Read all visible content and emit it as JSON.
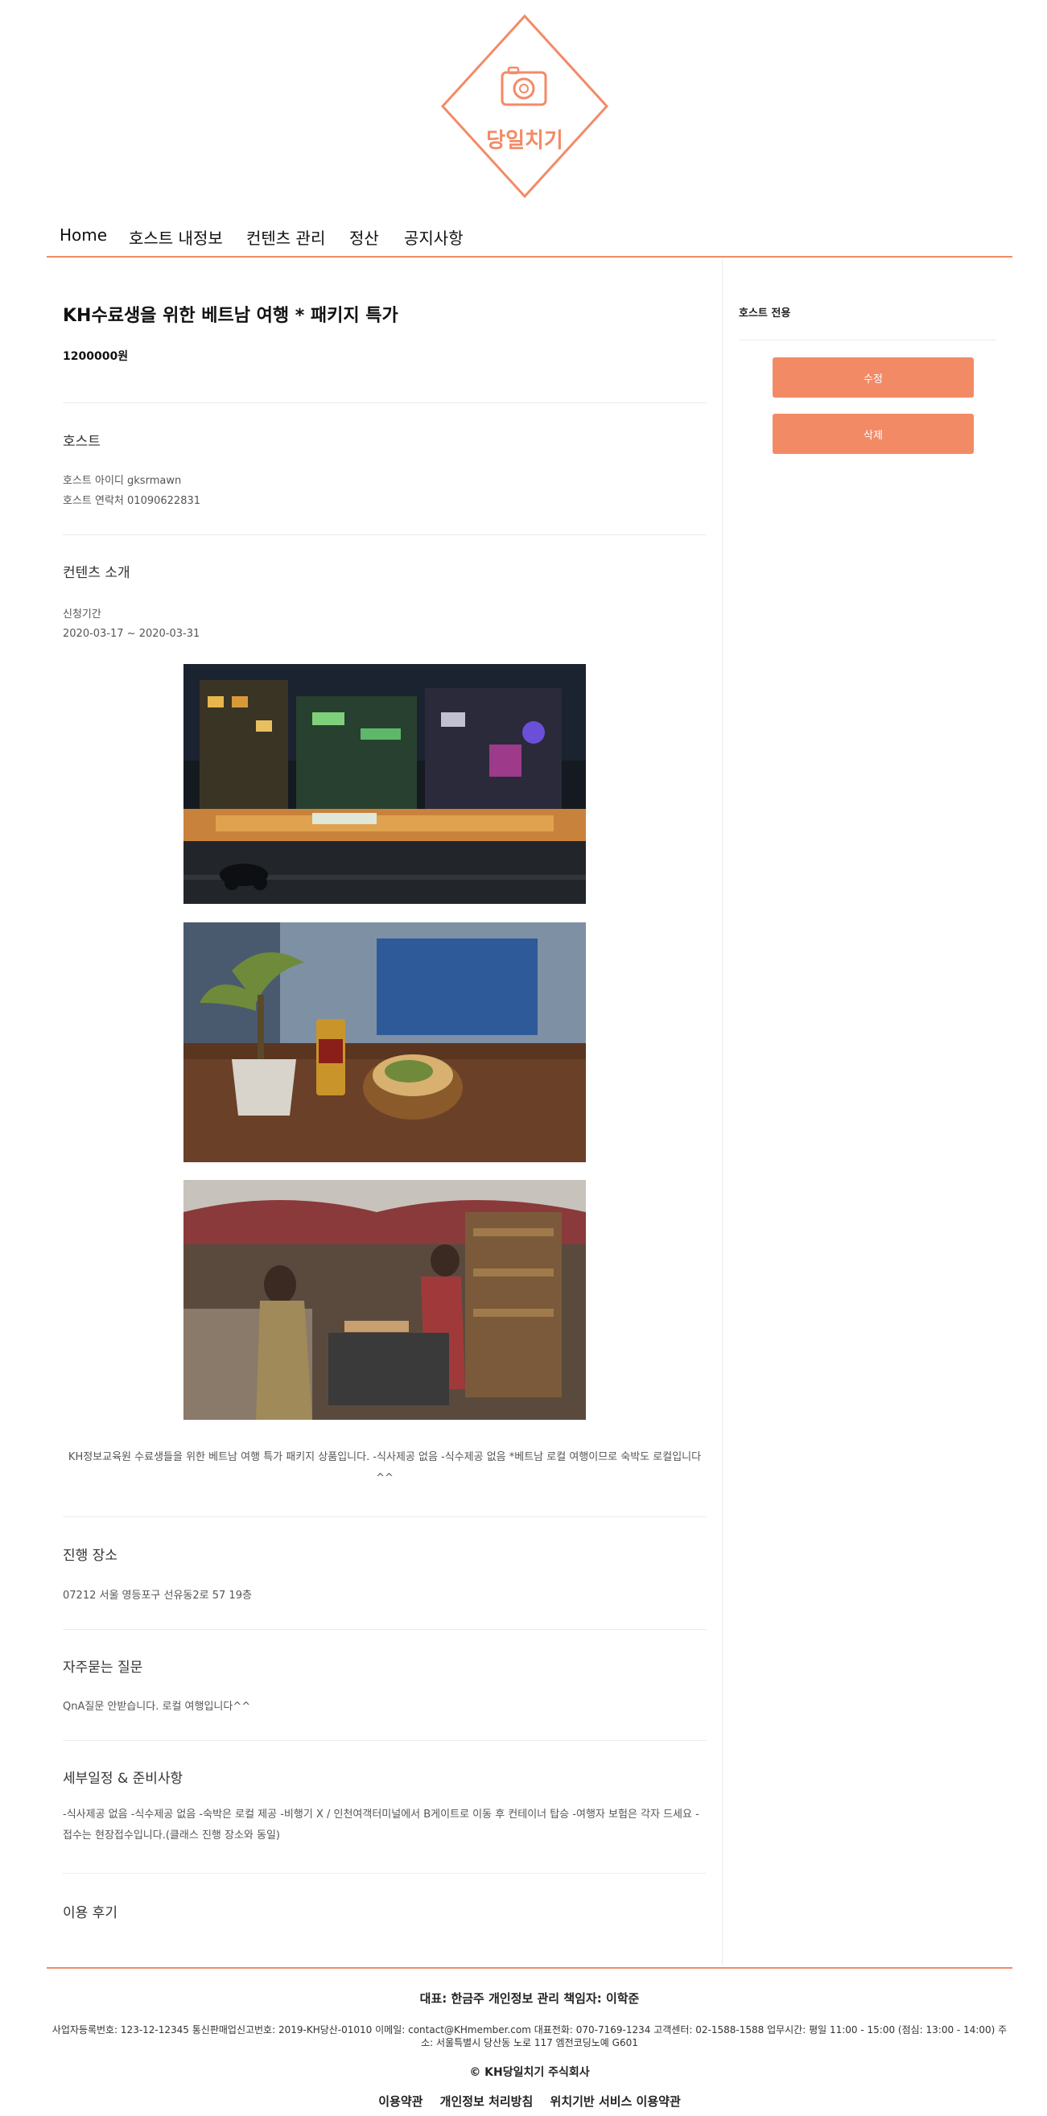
{
  "brand": {
    "name": "당일치기",
    "accent": "#f38a66"
  },
  "nav": {
    "items": [
      "Home",
      "호스트 내정보",
      "컨텐츠 관리",
      "정산",
      "공지사항"
    ]
  },
  "content": {
    "title": "KH수료생을 위한 베트남 여행 * 패키지 특가",
    "price": "1200000원",
    "host": {
      "heading": "호스트",
      "id_line": "호스트 아이디 gksrmawn",
      "contact_line": "호스트 연락처 01090622831"
    },
    "intro": {
      "heading": "컨텐츠 소개",
      "period_label": "신청기간",
      "period": "2020-03-17 ~ 2020-03-31",
      "photos": [
        "night-street-photo",
        "sandwich-beer-photo",
        "market-vendor-photo"
      ],
      "description": "KH정보교육원 수료생들을 위한 베트남 여행 특가 패키지 상품입니다. -식사제공 없음 -식수제공 없음 *베트남 로컬 여행이므로 숙박도 로컬입니다^^"
    },
    "location": {
      "heading": "진행 장소",
      "address": "07212 서울 영등포구 선유동2로 57 19층"
    },
    "faq": {
      "heading": "자주묻는 질문",
      "text": "QnA질문 안받습니다. 로컬 여행입니다^^"
    },
    "schedule": {
      "heading": "세부일정 & 준비사항",
      "text": "-식사제공 없음 -식수제공 없음 -숙박은 로컬 제공 -비행기 X / 인천여객터미널에서 B게이트로 이동 후 컨테이너 탑승 -여행자 보험은 각자 드세요 - 접수는 현장접수입니다.(클래스 진행 장소와 동일)"
    },
    "reviews": {
      "heading": "이용 후기"
    }
  },
  "sidebar": {
    "label": "호스트 전용",
    "edit_label": "수정",
    "delete_label": "삭제"
  },
  "footer": {
    "representative": "대표: 한금주 개인정보 관리 책임자: 이학준",
    "business_info": "사업자등록번호: 123-12-12345 통신판매업신고번호: 2019-KH당산-01010 이메일: contact@KHmember.com 대표전화: 070-7169-1234 고객센터: 02-1588-1588 업무시간: 평일 11:00 - 15:00 (점심: 13:00 - 14:00) 주소: 서울특별시 당산동 노로 117 엠전코딩노예 G601",
    "copyright": "© KH당일치기 주식회사",
    "links": [
      "이용약관",
      "개인정보 처리방침",
      "위치기반 서비스 이용약관"
    ]
  }
}
